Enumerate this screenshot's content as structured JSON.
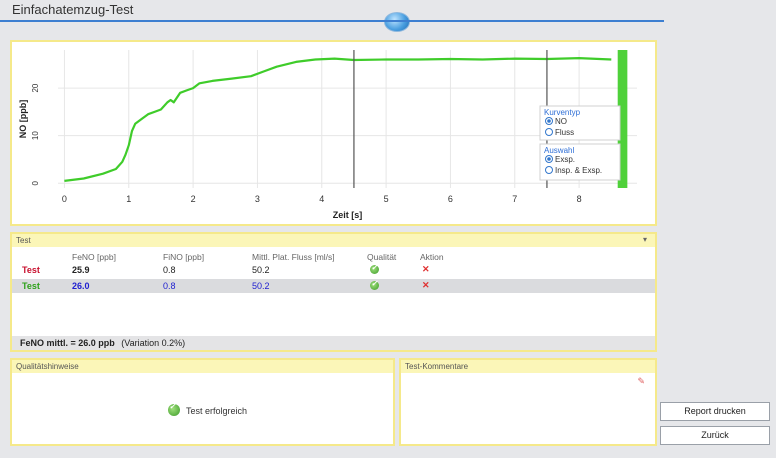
{
  "window": {
    "title": "Einfachatemzug-Test"
  },
  "chart_data": {
    "type": "line",
    "xlabel": "Zeit [s]",
    "ylabel": "NO [ppb]",
    "x_ticks": [
      "0",
      "1",
      "2",
      "3",
      "4",
      "5",
      "6",
      "7",
      "8"
    ],
    "y_ticks": [
      "0",
      "10",
      "20"
    ],
    "xlim": [
      -0.1,
      8.9
    ],
    "ylim": [
      -1,
      28
    ],
    "series": [
      {
        "color": "#3fcc2a",
        "x": [
          0,
          0.3,
          0.6,
          0.8,
          0.9,
          0.95,
          1.0,
          1.05,
          1.1,
          1.2,
          1.3,
          1.4,
          1.5,
          1.6,
          1.65,
          1.7,
          1.8,
          1.9,
          2.0,
          2.1,
          2.3,
          2.6,
          2.9,
          3.1,
          3.3,
          3.6,
          3.9,
          4.2,
          4.5,
          5.0,
          5.5,
          6.0,
          6.5,
          7.0,
          7.5,
          8.0,
          8.5
        ],
        "y": [
          0.5,
          1.0,
          2.0,
          3.0,
          4.5,
          6.0,
          8.0,
          11.0,
          12.5,
          13.5,
          14.5,
          15.0,
          15.5,
          17.0,
          17.5,
          17.0,
          19.0,
          19.5,
          20.0,
          21.0,
          21.5,
          22.0,
          22.5,
          23.5,
          24.5,
          25.5,
          26.0,
          26.2,
          25.9,
          26.0,
          26.0,
          26.1,
          26.0,
          26.2,
          26.1,
          26.3,
          26.0
        ]
      }
    ],
    "markers_x": [
      4.5,
      7.5
    ],
    "acceptance_window": {
      "x_start": 8.6,
      "x_end": 8.75
    },
    "grid": true,
    "legend": {
      "kurventyp_title": "Kurventyp",
      "kurventyp_options": [
        "NO",
        "Fluss"
      ],
      "kurventyp_selected": "NO",
      "auswahl_title": "Auswahl",
      "auswahl_options": [
        "Exsp.",
        "Insp. & Exsp."
      ],
      "auswahl_selected": "Exsp."
    }
  },
  "results": {
    "section_title": "Test",
    "columns": [
      "FeNO [ppb]",
      "FiNO [ppb]",
      "Mittl. Plat. Fluss [ml/s]",
      "Qualität",
      "Aktion"
    ],
    "rows": [
      {
        "name": "Test",
        "name_color": "#c8102e",
        "feno": "25.9",
        "fino": "0.8",
        "flow": "50.2",
        "value_color": "#222"
      },
      {
        "name": "Test",
        "name_color": "#2ea11b",
        "feno": "26.0",
        "fino": "0.8",
        "flow": "50.2",
        "value_color": "#2020d0"
      }
    ],
    "summary_bold": "FeNO mittl. = 26.0 ppb",
    "summary_extra": "(Variation 0.2%)"
  },
  "quality": {
    "title": "Qualitätshinweise",
    "message": "Test erfolgreich"
  },
  "comments": {
    "title": "Test-Kommentare"
  },
  "buttons": {
    "report": "Report drucken",
    "back": "Zurück"
  }
}
